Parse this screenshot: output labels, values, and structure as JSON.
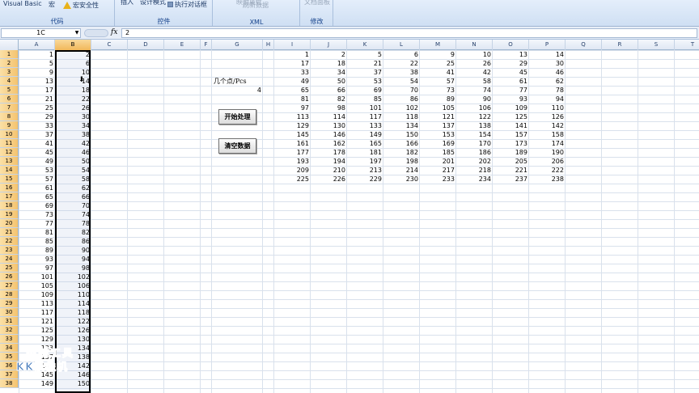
{
  "ribbon": {
    "groups": [
      {
        "label": "代码",
        "items": [
          "Visual Basic",
          "宏",
          "宏安全性"
        ]
      },
      {
        "label": "控件",
        "items": [
          "插入",
          "设计模式",
          "执行对话框"
        ]
      },
      {
        "label": "XML",
        "items": [
          "映射属性",
          "刷新数据"
        ]
      },
      {
        "label": "修改",
        "items": [
          "文档面板"
        ]
      }
    ]
  },
  "formula_bar": {
    "name_box": "1C",
    "fx": "fx",
    "value": "2"
  },
  "columns": [
    "A",
    "B",
    "C",
    "D",
    "E",
    "F",
    "G",
    "H",
    "I",
    "J",
    "K",
    "L",
    "M",
    "N",
    "O",
    "P",
    "Q",
    "R",
    "S",
    "T"
  ],
  "selected_column": "B",
  "rows": [
    "1",
    "2",
    "3",
    "4",
    "5",
    "6",
    "7",
    "8",
    "9",
    "10",
    "11",
    "12",
    "13",
    "14",
    "15",
    "16",
    "17",
    "18",
    "19",
    "20",
    "21",
    "22",
    "23",
    "24",
    "25",
    "26",
    "27",
    "28",
    "29",
    "30",
    "31",
    "32",
    "33",
    "34",
    "35",
    "36",
    "37",
    "38"
  ],
  "col_a": [
    "1",
    "5",
    "9",
    "13",
    "17",
    "21",
    "25",
    "29",
    "33",
    "37",
    "41",
    "45",
    "49",
    "53",
    "57",
    "61",
    "65",
    "69",
    "73",
    "77",
    "81",
    "85",
    "89",
    "93",
    "97",
    "101",
    "105",
    "109",
    "113",
    "117",
    "121",
    "125",
    "129",
    "133",
    "137",
    "141",
    "145",
    "149"
  ],
  "col_b": [
    "2",
    "6",
    "10",
    "14",
    "18",
    "22",
    "26",
    "30",
    "34",
    "38",
    "42",
    "46",
    "50",
    "54",
    "58",
    "62",
    "66",
    "70",
    "74",
    "78",
    "82",
    "86",
    "90",
    "94",
    "98",
    "102",
    "106",
    "110",
    "114",
    "118",
    "122",
    "126",
    "130",
    "134",
    "138",
    "142",
    "146",
    "150"
  ],
  "controls": {
    "pcs_label": "几个点/Pcs",
    "pcs_value": "4",
    "start_button": "开始处理",
    "clear_button": "清空数据"
  },
  "matrix": [
    [
      "1",
      "2",
      "5",
      "6",
      "9",
      "10",
      "13",
      "14"
    ],
    [
      "17",
      "18",
      "21",
      "22",
      "25",
      "26",
      "29",
      "30"
    ],
    [
      "33",
      "34",
      "37",
      "38",
      "41",
      "42",
      "45",
      "46"
    ],
    [
      "49",
      "50",
      "53",
      "54",
      "57",
      "58",
      "61",
      "62"
    ],
    [
      "65",
      "66",
      "69",
      "70",
      "73",
      "74",
      "77",
      "78"
    ],
    [
      "81",
      "82",
      "85",
      "86",
      "89",
      "90",
      "93",
      "94"
    ],
    [
      "97",
      "98",
      "101",
      "102",
      "105",
      "106",
      "109",
      "110"
    ],
    [
      "113",
      "114",
      "117",
      "118",
      "121",
      "122",
      "125",
      "126"
    ],
    [
      "129",
      "130",
      "133",
      "134",
      "137",
      "138",
      "141",
      "142"
    ],
    [
      "145",
      "146",
      "149",
      "150",
      "153",
      "154",
      "157",
      "158"
    ],
    [
      "161",
      "162",
      "165",
      "166",
      "169",
      "170",
      "173",
      "174"
    ],
    [
      "177",
      "178",
      "181",
      "182",
      "185",
      "186",
      "189",
      "190"
    ],
    [
      "193",
      "194",
      "197",
      "198",
      "201",
      "202",
      "205",
      "206"
    ],
    [
      "209",
      "210",
      "213",
      "214",
      "217",
      "218",
      "221",
      "222"
    ],
    [
      "225",
      "226",
      "229",
      "230",
      "233",
      "234",
      "237",
      "238"
    ]
  ],
  "watermark": {
    "line1": "录制工具",
    "line2": "KK录像机"
  },
  "colors": {
    "selected_header": "#f4c36f",
    "grid_line": "#d9e1ec",
    "ribbon": "#dbe7f6"
  }
}
